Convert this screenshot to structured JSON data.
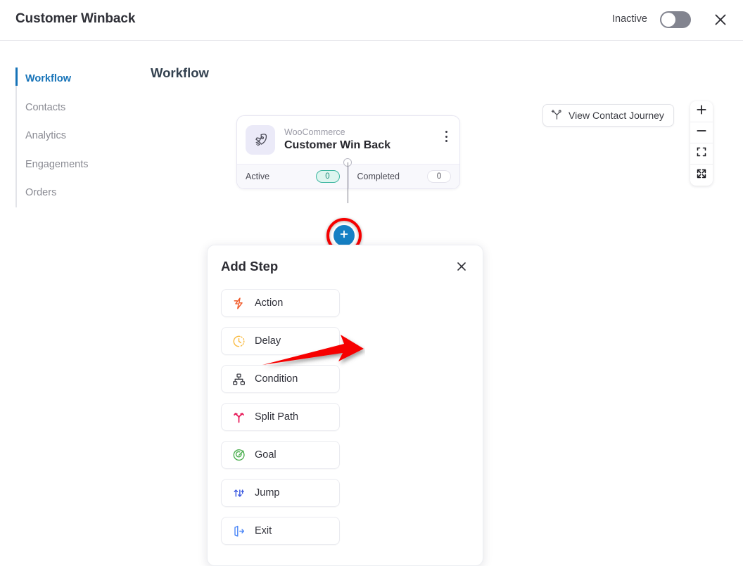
{
  "header": {
    "title": "Customer Winback",
    "status_label": "Inactive",
    "toggle_state": "off",
    "close_icon": "close-icon"
  },
  "sidebar": {
    "items": [
      {
        "label": "Workflow",
        "active": true
      },
      {
        "label": "Contacts",
        "active": false
      },
      {
        "label": "Analytics",
        "active": false
      },
      {
        "label": "Engagements",
        "active": false
      },
      {
        "label": "Orders",
        "active": false
      }
    ],
    "active_color": "#1673b8"
  },
  "canvas": {
    "title": "Workflow",
    "journey_button": {
      "label": "View Contact Journey",
      "icon": "journey-split-icon"
    },
    "zoom_controls": [
      {
        "name": "zoom-in-button",
        "icon": "plus-icon"
      },
      {
        "name": "zoom-out-button",
        "icon": "minus-icon"
      },
      {
        "name": "fit-view-button",
        "icon": "fit-frame-icon"
      },
      {
        "name": "fullscreen-button",
        "icon": "expand-arrows-icon"
      }
    ]
  },
  "trigger_node": {
    "icon": "rocket-icon",
    "subtitle": "WooCommerce",
    "name": "Customer Win Back",
    "menu_icon": "more-vertical-icon",
    "stats": [
      {
        "label": "Active",
        "value": "0",
        "style": "active"
      },
      {
        "label": "Completed",
        "value": "0",
        "style": "completed"
      }
    ]
  },
  "add_node_button": {
    "icon": "plus-icon",
    "highlight_color": "#f60000",
    "button_color": "#1580c4"
  },
  "add_step_panel": {
    "title": "Add Step",
    "close_icon": "close-icon",
    "options": [
      {
        "label": "Action",
        "icon": "zap-icon",
        "color": "#f15a29"
      },
      {
        "label": "Delay",
        "icon": "clock-dash-icon",
        "color": "#f9bb42"
      },
      {
        "label": "Condition",
        "icon": "hierarchy-icon",
        "color": "#3b3c44"
      },
      {
        "label": "Split Path",
        "icon": "split-path-icon",
        "color": "#e8225f"
      },
      {
        "label": "Goal",
        "icon": "target-icon",
        "color": "#4caf50"
      },
      {
        "label": "Jump",
        "icon": "jump-icon",
        "color": "#3b59e0"
      },
      {
        "label": "Exit",
        "icon": "exit-door-icon",
        "color": "#4a86f7"
      }
    ]
  },
  "annotations": [
    {
      "name": "red-arrow-annotation",
      "target": "Action",
      "color": "#f60000"
    },
    {
      "name": "red-ring-annotation",
      "target": "add-node-button",
      "color": "#f60000"
    }
  ]
}
